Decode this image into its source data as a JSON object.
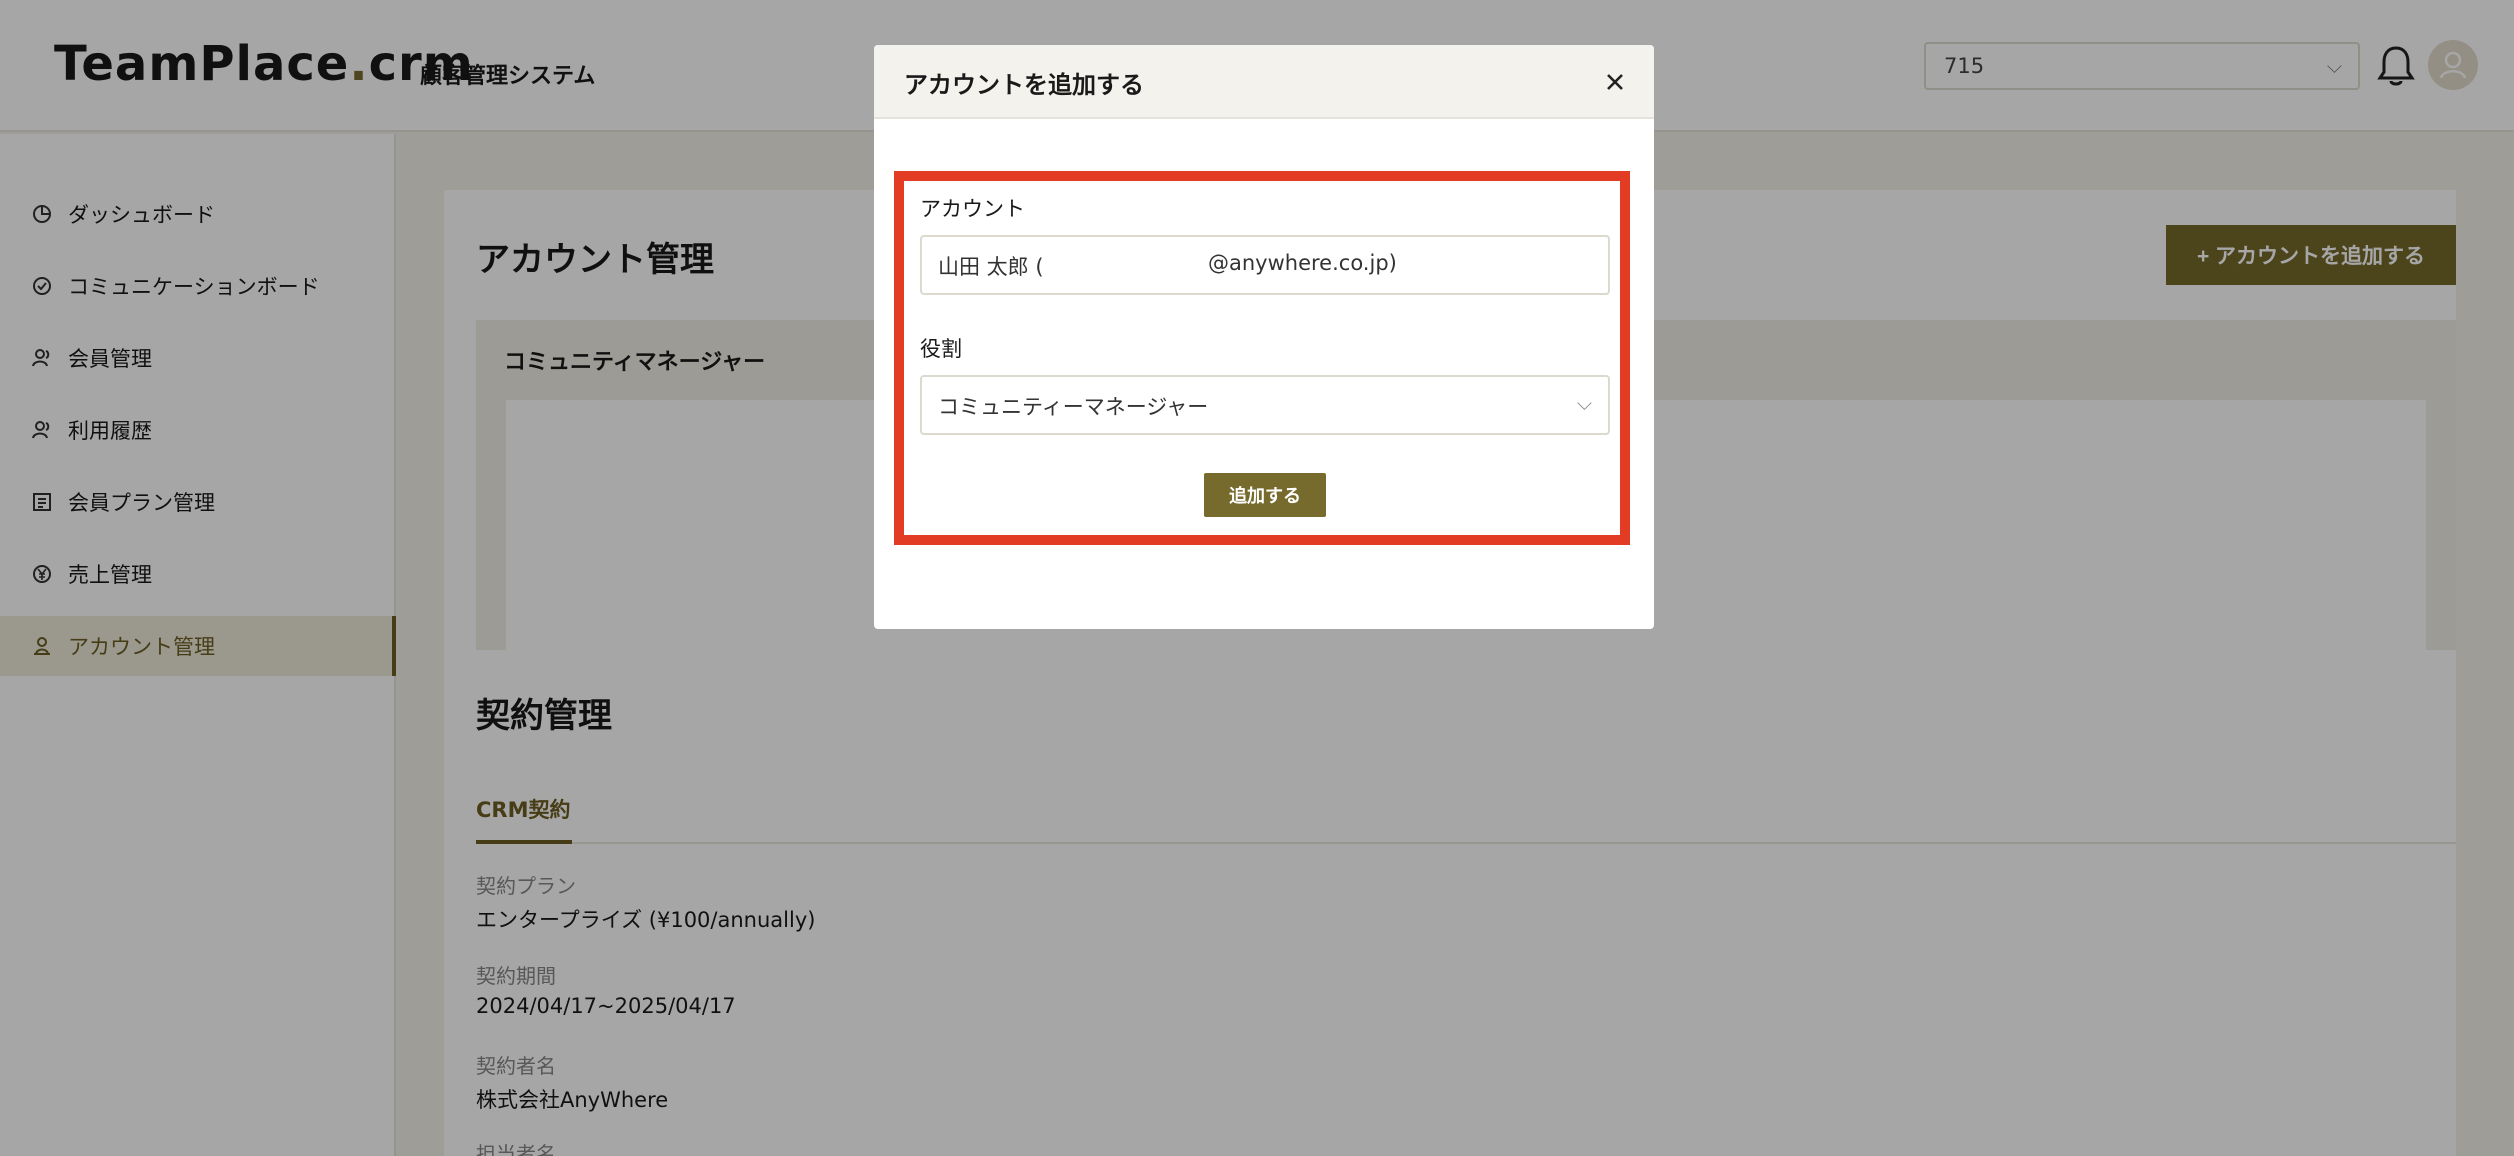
{
  "header": {
    "logo_prefix": "TeamPlace",
    "logo_dot": ".",
    "logo_suffix": "crm",
    "subtitle": "顧客管理システム",
    "store_select_value": "715"
  },
  "sidebar": {
    "items": [
      {
        "label": "ダッシュボード",
        "icon": "pie-chart-icon"
      },
      {
        "label": "コミュニケーションボード",
        "icon": "check-circle-icon"
      },
      {
        "label": "会員管理",
        "icon": "users-icon"
      },
      {
        "label": "利用履歴",
        "icon": "users-icon"
      },
      {
        "label": "会員プラン管理",
        "icon": "list-icon"
      },
      {
        "label": "売上管理",
        "icon": "yen-icon"
      },
      {
        "label": "アカウント管理",
        "icon": "user-shield-icon",
        "active": true
      }
    ]
  },
  "main": {
    "title": "アカウント管理",
    "add_button": "+ アカウントを追加する",
    "section_title": "コミュニティマネージャー",
    "contract_title": "契約管理",
    "tab_label": "CRM契約",
    "fields": [
      {
        "label": "契約プラン",
        "value": "エンタープライズ (¥100/annually)"
      },
      {
        "label": "契約期間",
        "value": "2024/04/17~2025/04/17"
      },
      {
        "label": "契約者名",
        "value": "株式会社AnyWhere"
      },
      {
        "label": "担当者名",
        "value": ""
      }
    ]
  },
  "modal": {
    "title": "アカウントを追加する",
    "account_label": "アカウント",
    "account_value_name": "山田 太郎 (",
    "account_value_email": "@anywhere.co.jp)",
    "role_label": "役割",
    "role_value": "コミュニティーマネージャー",
    "submit_label": "追加する"
  },
  "colors": {
    "accent": "#766a2c",
    "highlight_border": "#e23c24"
  }
}
